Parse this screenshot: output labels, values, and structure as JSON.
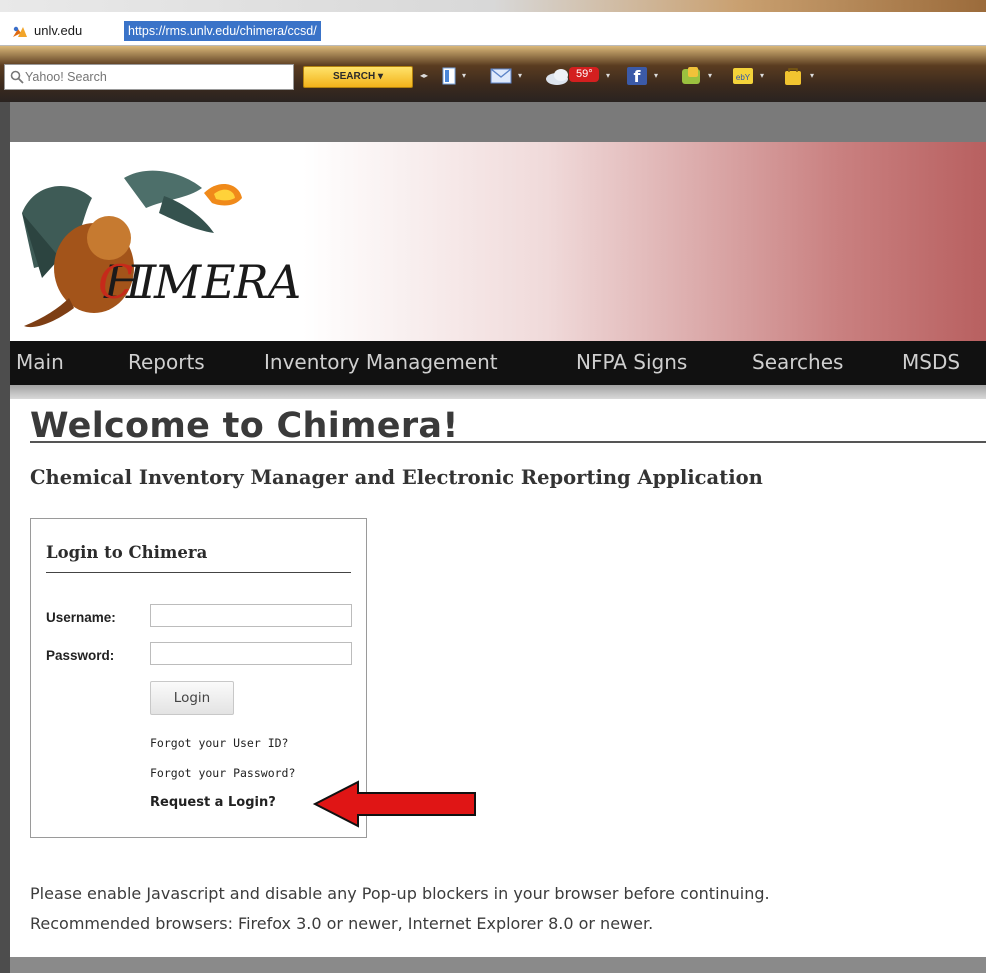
{
  "browser": {
    "site_name": "unlv.edu",
    "url": "https://rms.unlv.edu/chimera/ccsd/"
  },
  "toolbar": {
    "search_placeholder": "Yahoo! Search",
    "search_button": "SEARCH",
    "weather_temp": "59°"
  },
  "site": {
    "logo_text": "CHIMERA"
  },
  "nav": {
    "items": [
      "Main",
      "Reports",
      "Inventory Management",
      "NFPA Signs",
      "Searches",
      "MSDS"
    ]
  },
  "content": {
    "welcome": "Welcome to Chimera!",
    "subtitle": "Chemical Inventory Manager and Electronic Reporting Application",
    "login": {
      "title": "Login to Chimera",
      "username_label": "Username:",
      "password_label": "Password:",
      "button": "Login",
      "forgot_userid": "Forgot your User ID?",
      "forgot_password": "Forgot your Password?",
      "request_login": "Request a Login?"
    },
    "notice_line1": "Please enable Javascript and disable any Pop-up blockers in your browser before continuing.",
    "notice_line2": "Recommended browsers: Firefox 3.0 or newer, Internet Explorer 8.0 or newer."
  },
  "colors": {
    "annotation_arrow": "#e01515",
    "nav_background": "#111111",
    "url_highlight": "#3a73c8"
  }
}
